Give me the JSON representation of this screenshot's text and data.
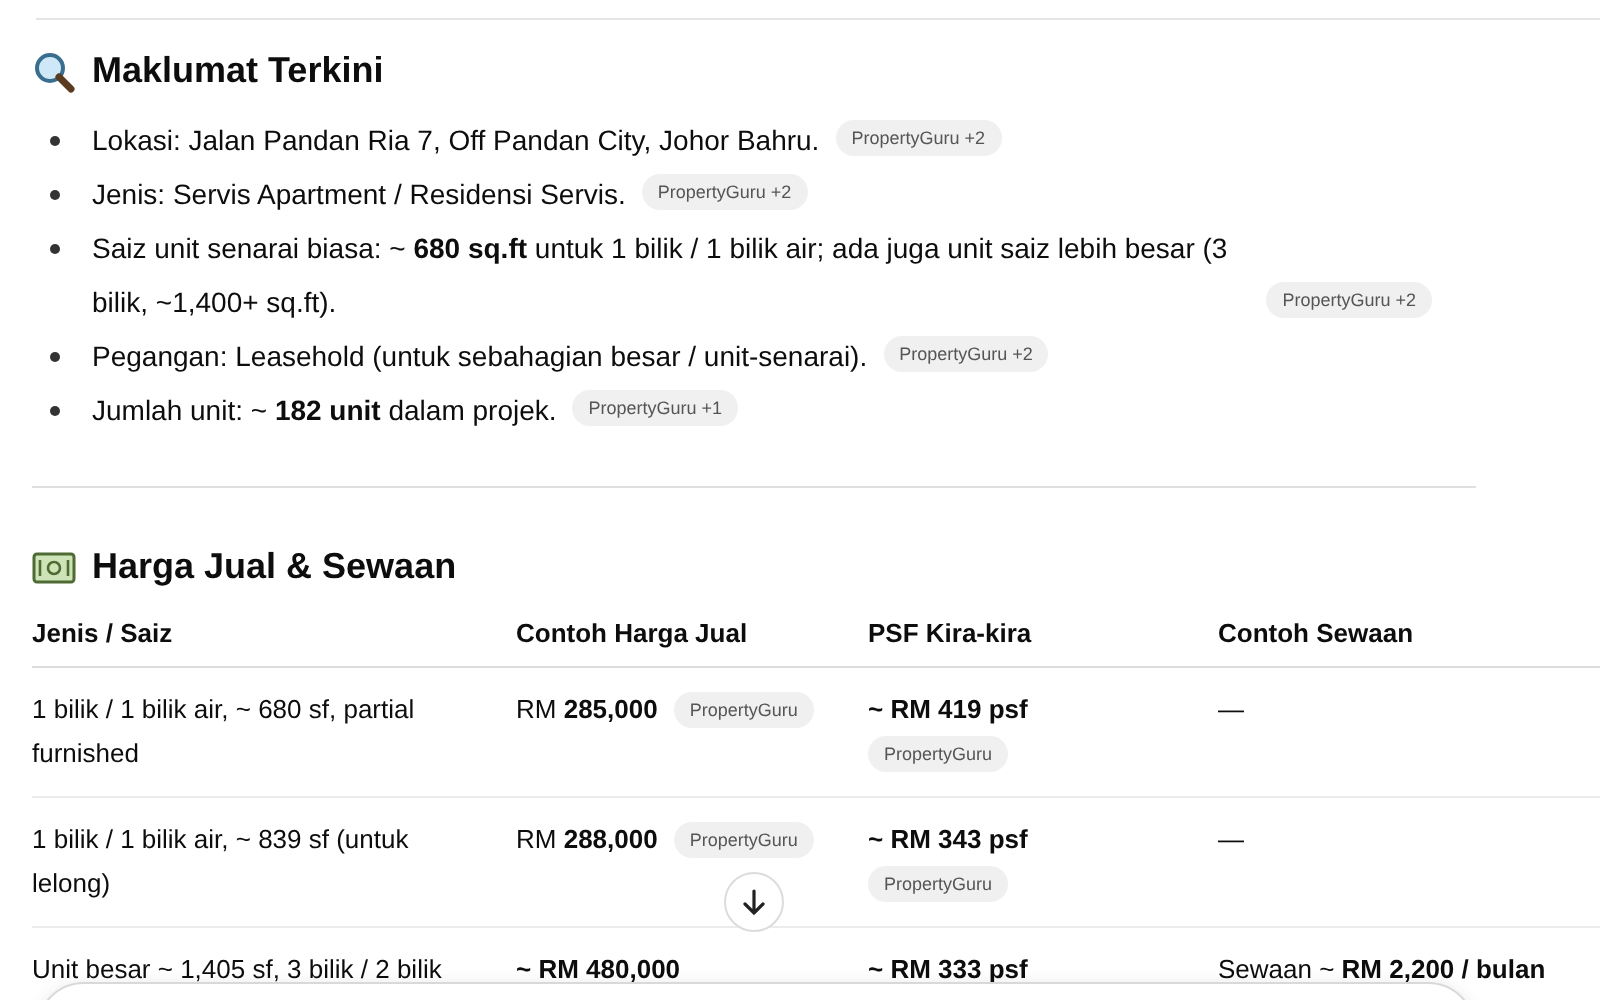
{
  "sections": [
    {
      "heading": {
        "title": "Maklumat Terkini"
      },
      "bullets": [
        {
          "text": "Lokasi: Jalan Pandan Ria 7, Off Pandan City, Johor Bahru.",
          "citation": "PropertyGuru",
          "more": "+2"
        },
        {
          "text": "Jenis: Servis Apartment / Residensi Servis.",
          "citation": "PropertyGuru",
          "more": "+2"
        },
        {
          "text": "Saiz unit senarai biasa: ~ **680 sq.ft** untuk 1 bilik / 1 bilik air; ada juga unit saiz lebih besar (3 bilik, ~1,400+ sq.ft).",
          "citation": "PropertyGuru",
          "more": "+2"
        },
        {
          "text": "Pegangan: Leasehold (untuk sebahagian besar / unit-senarai).",
          "citation": "PropertyGuru",
          "more": "+2"
        },
        {
          "text": "Jumlah unit: ~ **182 unit** dalam projek.",
          "citation": "PropertyGuru",
          "more": "+1"
        }
      ]
    },
    {
      "heading": {
        "title": "Harga Jual & Sewaan"
      },
      "table": {
        "columns": [
          "Jenis / Saiz",
          "Contoh Harga Jual",
          "PSF Kira-kira",
          "Contoh Sewaan"
        ],
        "rows": [
          [
            {
              "text": "1 bilik / 1 bilik air, ~ 680 sf, partial furnished"
            },
            {
              "text": "RM **285,000**",
              "citation": "PropertyGuru"
            },
            {
              "text": "**~ RM 419 psf**",
              "citation": "PropertyGuru"
            },
            {
              "text": "—"
            }
          ],
          [
            {
              "text": "1 bilik / 1 bilik air, ~ 839 sf (untuk lelong)"
            },
            {
              "text": "RM **288,000**",
              "citation": "PropertyGuru"
            },
            {
              "text": "**~ RM 343 psf**",
              "citation": "PropertyGuru"
            },
            {
              "text": "—"
            }
          ],
          [
            {
              "text": "Unit besar ~ 1,405 sf, 3 bilik / 2 bilik"
            },
            {
              "text": "**~ RM 480,000**"
            },
            {
              "text": "**~ RM 333 psf**"
            },
            {
              "text": "Sewaan ~ **RM 2,200 / bulan**"
            }
          ]
        ]
      }
    }
  ]
}
